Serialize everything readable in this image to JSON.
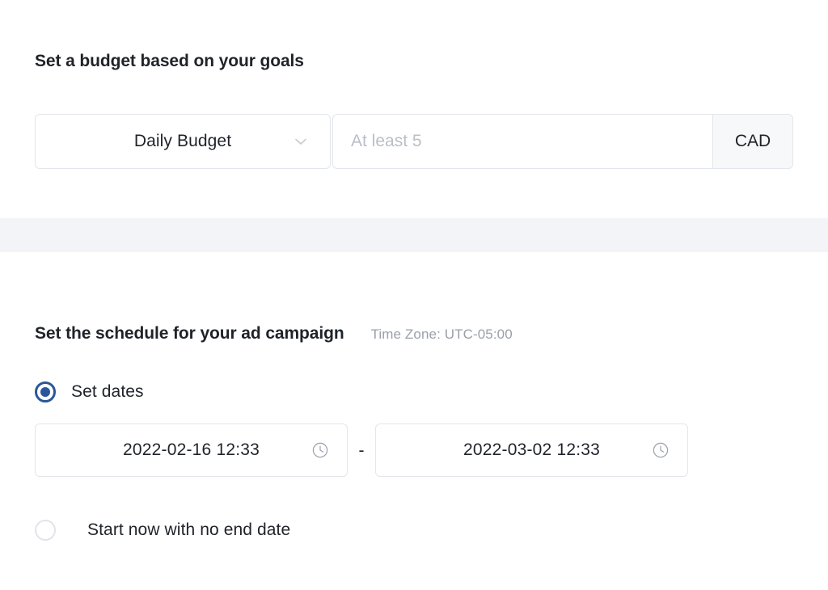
{
  "budget": {
    "title": "Set a budget based on your goals",
    "type_select": {
      "value": "Daily Budget",
      "icon": "chevron-down-icon"
    },
    "amount_input": {
      "value": "",
      "placeholder": "At least 5"
    },
    "currency": "CAD"
  },
  "schedule": {
    "title": "Set the schedule for your ad campaign",
    "timezone": "Time Zone: UTC-05:00",
    "options": [
      {
        "label": "Set dates",
        "selected": true
      },
      {
        "label": "Start now with no end date",
        "selected": false
      }
    ],
    "date_range": {
      "start": "2022-02-16 12:33",
      "end": "2022-03-02 12:33",
      "separator": "-",
      "icon": "clock-icon"
    }
  },
  "colors": {
    "accent": "#2b5699",
    "text": "#1f2329",
    "muted_text": "#9aa0aa",
    "placeholder": "#b9bec7",
    "border": "#e3e6eb",
    "addon_bg": "#f7f8fa",
    "band_bg": "#f2f4f8"
  }
}
